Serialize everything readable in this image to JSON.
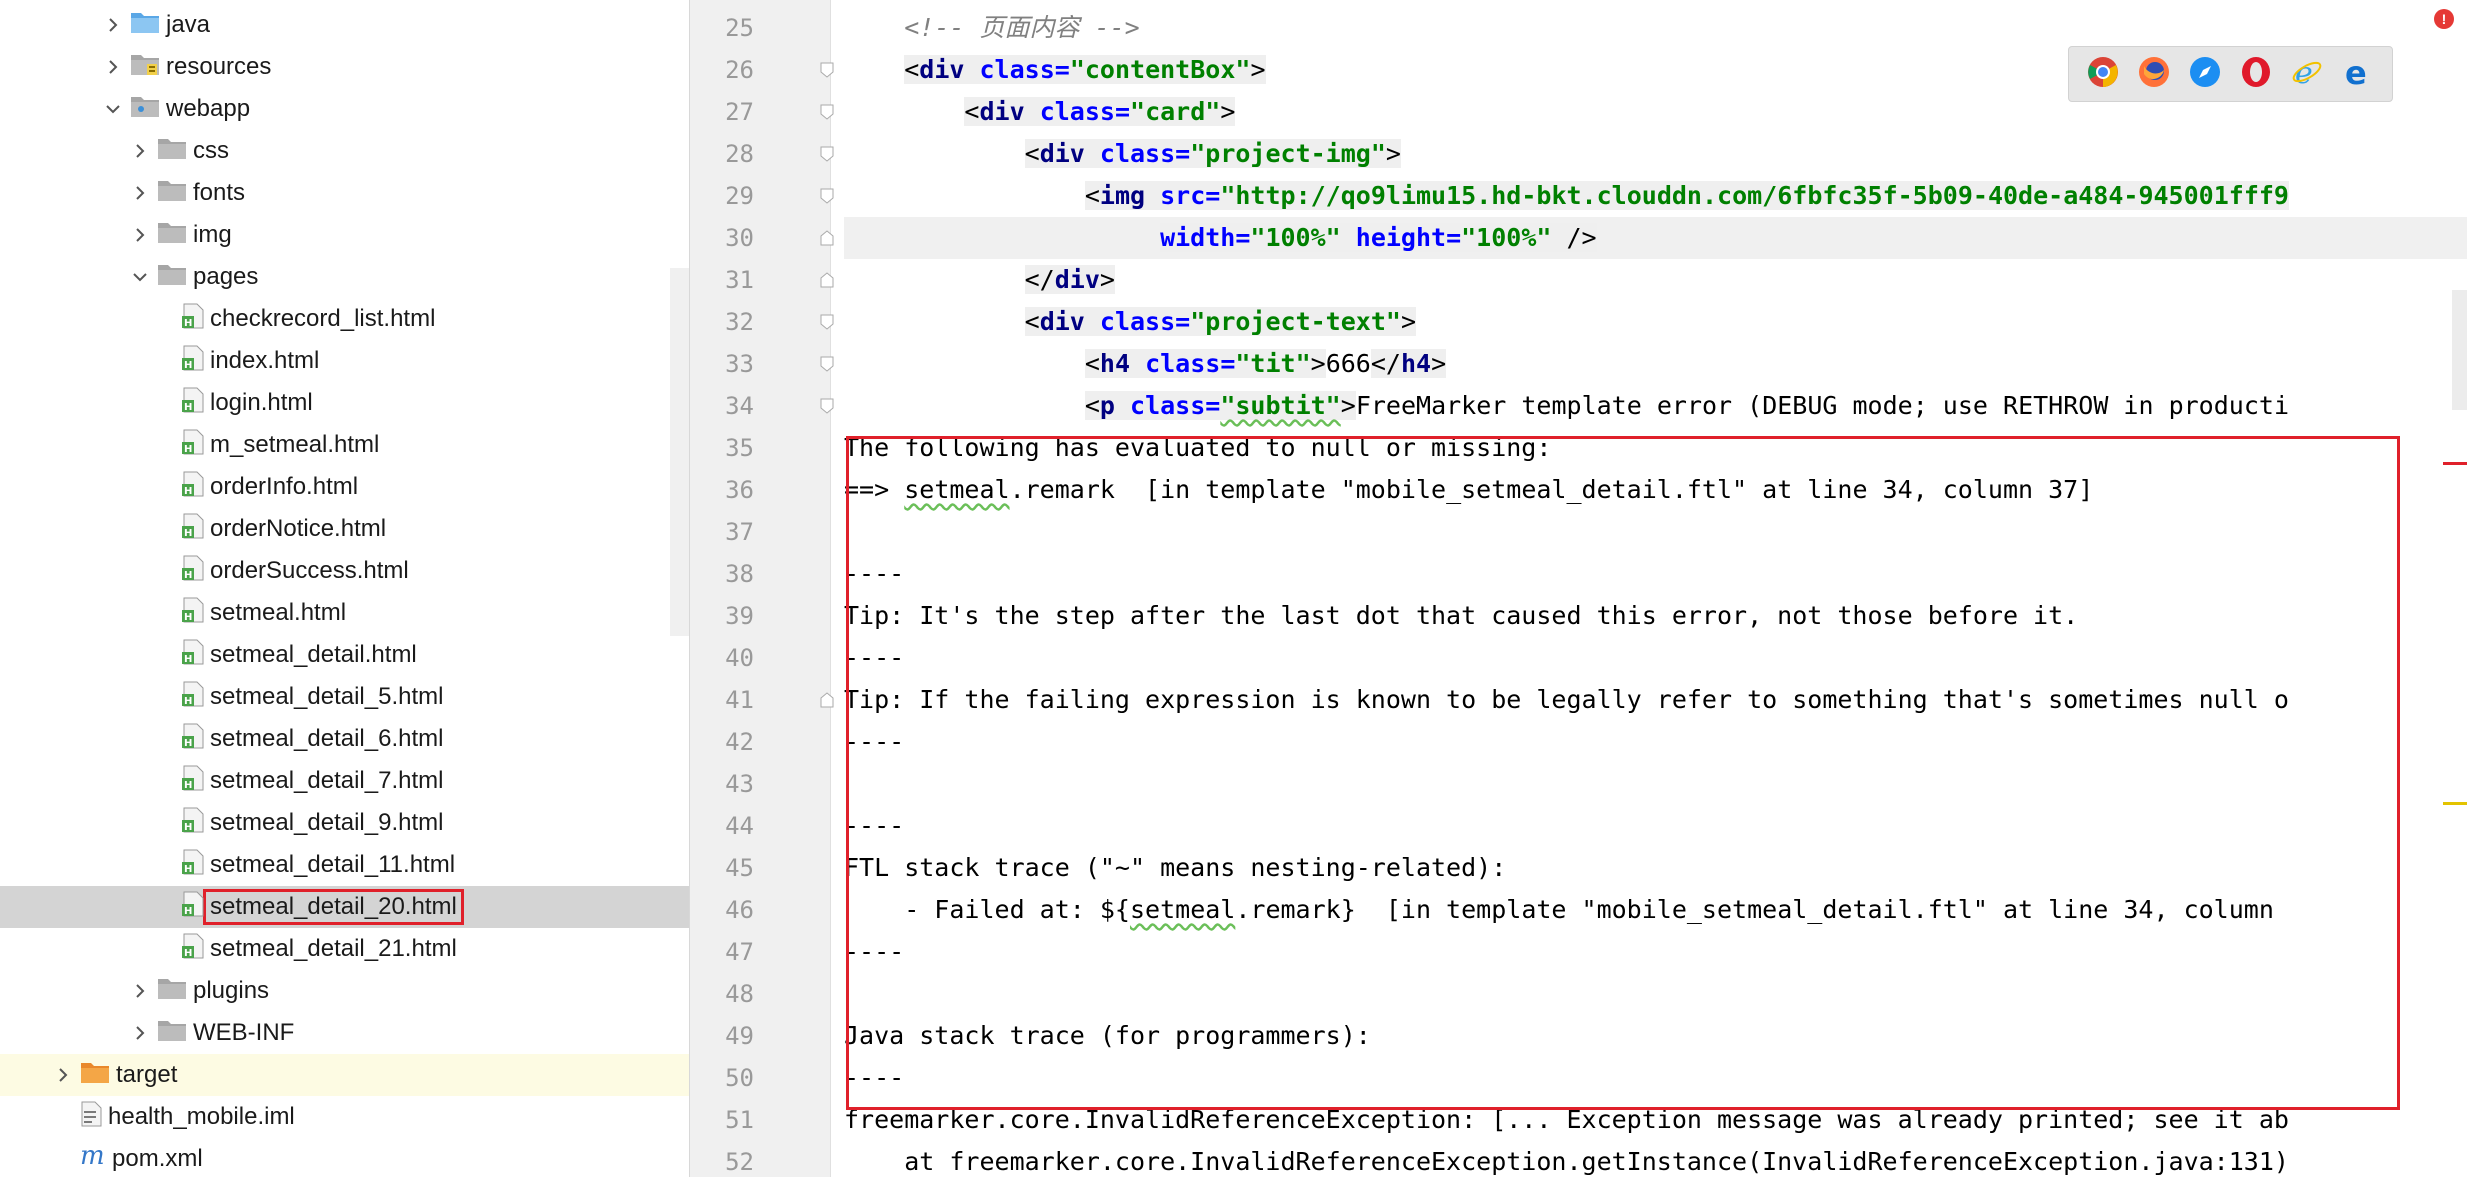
{
  "tree": {
    "items": [
      {
        "label": "java",
        "icon": "folder-blue-icon",
        "arrow": "right",
        "depth": 0
      },
      {
        "label": "resources",
        "icon": "resources-folder-icon",
        "arrow": "right",
        "depth": 0
      },
      {
        "label": "webapp",
        "icon": "web-folder-icon",
        "arrow": "down",
        "depth": 0
      },
      {
        "label": "css",
        "icon": "folder-icon",
        "arrow": "right",
        "depth": 1
      },
      {
        "label": "fonts",
        "icon": "folder-icon",
        "arrow": "right",
        "depth": 1
      },
      {
        "label": "img",
        "icon": "folder-icon",
        "arrow": "right",
        "depth": 1
      },
      {
        "label": "pages",
        "icon": "folder-icon",
        "arrow": "down",
        "depth": 1
      },
      {
        "label": "checkrecord_list.html",
        "icon": "html-file-icon",
        "depth": 2
      },
      {
        "label": "index.html",
        "icon": "html-file-icon",
        "depth": 2
      },
      {
        "label": "login.html",
        "icon": "html-file-icon",
        "depth": 2
      },
      {
        "label": "m_setmeal.html",
        "icon": "html-file-icon",
        "depth": 2
      },
      {
        "label": "orderInfo.html",
        "icon": "html-file-icon",
        "depth": 2
      },
      {
        "label": "orderNotice.html",
        "icon": "html-file-icon",
        "depth": 2
      },
      {
        "label": "orderSuccess.html",
        "icon": "html-file-icon",
        "depth": 2
      },
      {
        "label": "setmeal.html",
        "icon": "html-file-icon",
        "depth": 2
      },
      {
        "label": "setmeal_detail.html",
        "icon": "html-file-icon",
        "depth": 2
      },
      {
        "label": "setmeal_detail_5.html",
        "icon": "html-file-icon",
        "depth": 2
      },
      {
        "label": "setmeal_detail_6.html",
        "icon": "html-file-icon",
        "depth": 2
      },
      {
        "label": "setmeal_detail_7.html",
        "icon": "html-file-icon",
        "depth": 2
      },
      {
        "label": "setmeal_detail_9.html",
        "icon": "html-file-icon",
        "depth": 2
      },
      {
        "label": "setmeal_detail_11.html",
        "icon": "html-file-icon",
        "depth": 2
      },
      {
        "label": "setmeal_detail_20.html",
        "icon": "html-file-icon",
        "depth": 2,
        "selected": true
      },
      {
        "label": "setmeal_detail_21.html",
        "icon": "html-file-icon",
        "depth": 2
      },
      {
        "label": "plugins",
        "icon": "folder-icon",
        "arrow": "right",
        "depth": 1
      },
      {
        "label": "WEB-INF",
        "icon": "folder-icon",
        "arrow": "right",
        "depth": 1
      },
      {
        "label": "target",
        "icon": "folder-orange-icon",
        "arrow": "right",
        "depth": -2,
        "highlight": true
      },
      {
        "label": "health_mobile.iml",
        "icon": "iml-file-icon",
        "depth": -2
      },
      {
        "label": "pom.xml",
        "icon": "maven-icon",
        "depth": -2
      }
    ]
  },
  "editor": {
    "line_numbers": [
      "25",
      "26",
      "27",
      "28",
      "29",
      "30",
      "31",
      "32",
      "33",
      "34",
      "35",
      "36",
      "37",
      "38",
      "39",
      "40",
      "41",
      "42",
      "43",
      "44",
      "45",
      "46",
      "47",
      "48",
      "49",
      "50",
      "51",
      "52"
    ],
    "line_25": {
      "comment": "<!-- 页面内容 -->"
    },
    "line_26": {
      "lt": "<",
      "tag": "div",
      "sp": " ",
      "attr": "class=",
      "val": "\"contentBox\"",
      "gt": ">"
    },
    "line_27": {
      "lt": "<",
      "tag": "div",
      "sp": " ",
      "attr": "class=",
      "val": "\"card\"",
      "gt": ">"
    },
    "line_28": {
      "lt": "<",
      "tag": "div",
      "sp": " ",
      "attr": "class=",
      "val": "\"project-img\"",
      "gt": ">"
    },
    "line_29": {
      "lt": "<",
      "tag": "img",
      "sp": " ",
      "attr": "src=",
      "val": "\"http://qo9limu15.hd-bkt.clouddn.com/6fbfc35f-5b09-40de-a484-945001fff9"
    },
    "line_30": {
      "attr1": "width=",
      "val1": "\"100%\"",
      "sp": " ",
      "attr2": "height=",
      "val2": "\"100%\"",
      "end": " />"
    },
    "line_31": {
      "close": "</",
      "tag": "div",
      "gt": ">"
    },
    "line_32": {
      "lt": "<",
      "tag": "div",
      "sp": " ",
      "attr": "class=",
      "val": "\"project-text\"",
      "gt": ">"
    },
    "line_33": {
      "lt": "<",
      "tag": "h4",
      "sp": " ",
      "attr": "class=",
      "val": "\"tit\"",
      "gt": ">",
      "text": "666",
      "close": "</",
      "ctag": "h4",
      "cgt": ">"
    },
    "line_34": {
      "lt": "<",
      "tag": "p",
      "sp": " ",
      "attr": "class=",
      "val": "\"subtit\"",
      "gt": ">",
      "text": "FreeMarker template error (DEBUG mode; use RETHROW in producti"
    },
    "line_35": "The following has evaluated to null or missing:",
    "line_36": {
      "pre": "==> ",
      "sq": "setmeal",
      "rest": ".remark  [in template \"mobile_setmeal_detail.ftl\" at line 34, column 37]"
    },
    "line_37": "",
    "line_38": "----",
    "line_39": "Tip: It's the step after the last dot that caused this error, not those before it.",
    "line_40": "----",
    "line_41": "Tip: If the failing expression is known to be legally refer to something that's sometimes null o",
    "line_42": "----",
    "line_43": "",
    "line_44": "----",
    "line_45": "FTL stack trace (\"~\" means nesting-related):",
    "line_46": {
      "pre": "    - Failed at: ${",
      "sq": "setmeal",
      "rest": ".remark}  [in template \"mobile_setmeal_detail.ftl\" at line 34, column "
    },
    "line_47": "----",
    "line_48": "",
    "line_49": "Java stack trace (for programmers):",
    "line_50": "----",
    "line_51": "freemarker.core.InvalidReferenceException: [... Exception message was already printed; see it ab",
    "line_52": "    at freemarker.core.InvalidReferenceException.getInstance(InvalidReferenceException.java:131)"
  },
  "browser_bar": {
    "icons": [
      "chrome-icon",
      "firefox-icon",
      "safari-icon",
      "opera-icon",
      "ie-icon",
      "edge-icon"
    ]
  },
  "notification": {
    "label": "!"
  },
  "colors": {
    "tag": "#000080",
    "attr": "#0000ff",
    "value": "#008000",
    "comment": "#808080",
    "highlight_box": "#e0202a",
    "selection": "#d4d4d4"
  }
}
